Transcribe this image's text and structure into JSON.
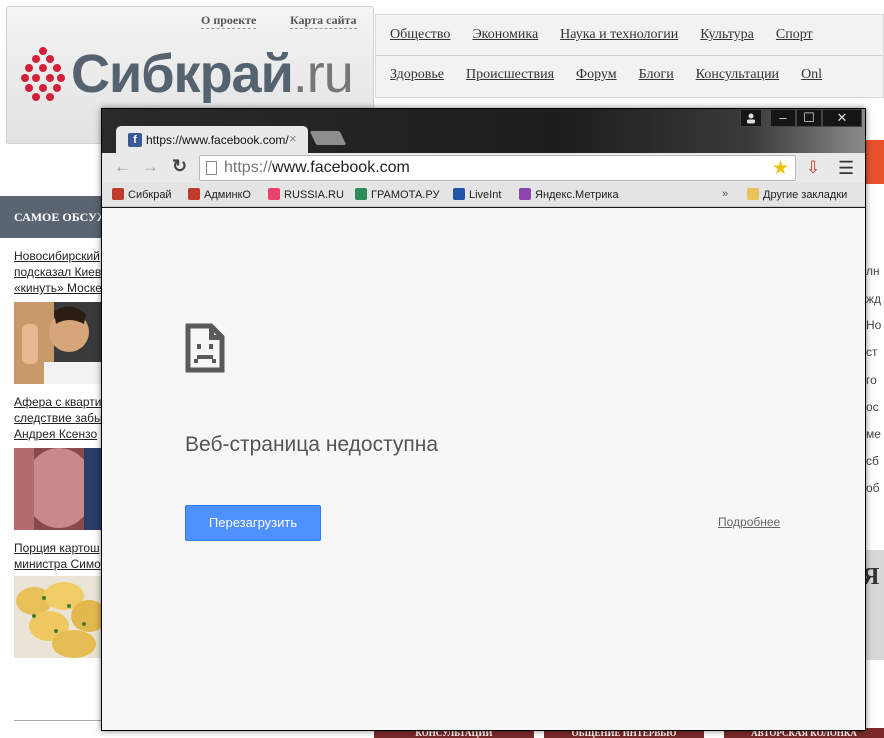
{
  "site": {
    "logo_text_main": "Сибкрай",
    "logo_text_suffix": ".ru",
    "top_links": [
      "О проекте",
      "Карта сайта"
    ],
    "nav_row1": [
      "Общество",
      "Экономика",
      "Наука и технологии",
      "Культура",
      "Спорт"
    ],
    "nav_row2": [
      "Здоровье",
      "Происшествия",
      "Форум",
      "Блоги",
      "Консультации",
      "Onl"
    ],
    "discussed_header": "САМОЕ ОБСУЖ",
    "news": [
      {
        "lines": [
          "Новосибирский",
          "подсказал Киев",
          "«кинуть» Моске"
        ]
      },
      {
        "lines": [
          "Афера с кварти",
          "следствие забы",
          "Андрея Ксензо"
        ]
      },
      {
        "lines": [
          "Порция картош",
          "министра Симо"
        ]
      }
    ],
    "right_strip": [
      "лн",
      "жд",
      "Но",
      "ст",
      "го",
      "ос",
      "ме",
      "сб",
      "об"
    ],
    "right_banner_letter": "Я",
    "bottom_tabs": [
      "КОНСУЛЬТАЦИИ",
      "ОБЩЕНИЕ ИНТЕРВЬЮ",
      "АВТОРСКАЯ КОЛОНКА"
    ]
  },
  "browser": {
    "tab_title": "https://www.facebook.com/",
    "tab_favicon": "f",
    "tab_close": "×",
    "url_protocol": "https://",
    "url_host": "www.facebook.com",
    "window_controls": [
      "–",
      "☐",
      "✕"
    ],
    "bookmarks": [
      {
        "label": "Сибкрай",
        "color": "#c0392b"
      },
      {
        "label": "АдминкО",
        "color": "#c0392b"
      },
      {
        "label": "RUSSIA.RU",
        "color": "#e8436a"
      },
      {
        "label": "ГРАМОТА.РУ",
        "color": "#2e8b57"
      },
      {
        "label": "LiveInt",
        "color": "#2255aa"
      },
      {
        "label": "Яндекс.Метрика",
        "color": "#8e44ad"
      }
    ],
    "bookmarks_overflow": "»",
    "other_bookmarks": "Другие закладки",
    "error_title": "Веб-страница недоступна",
    "reload_button": "Перезагрузить",
    "details_link": "Подробнее"
  },
  "colors": {
    "accent_button": "#4d90fe",
    "facebook_blue": "#3b5998"
  }
}
